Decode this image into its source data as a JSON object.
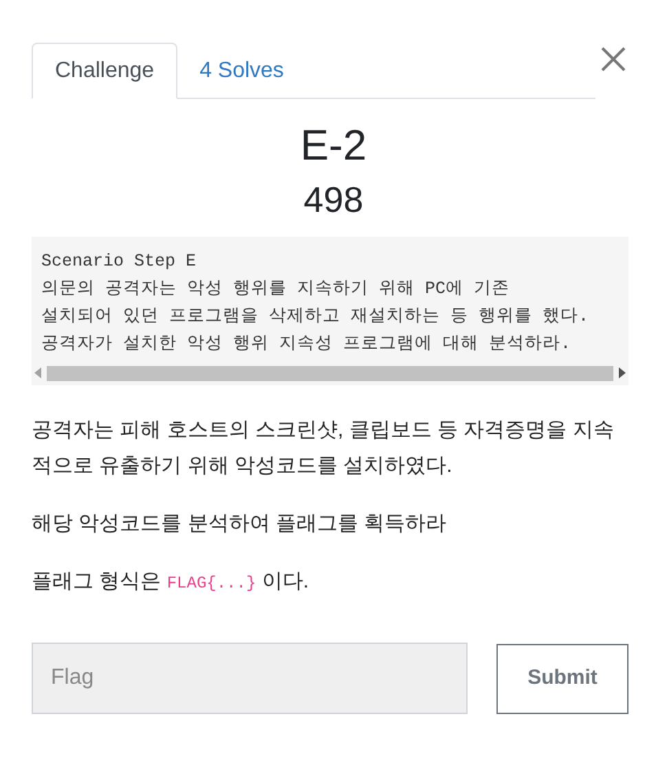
{
  "tabs": [
    {
      "label": "Challenge",
      "selected": true
    },
    {
      "label": "4 Solves",
      "selected": false
    }
  ],
  "title": "E-2",
  "points": "498",
  "scenario_lines": [
    "Scenario Step E",
    "의문의 공격자는 악성 행위를 지속하기 위해 PC에 기존",
    "설치되어 있던 프로그램을 삭제하고 재설치하는 등 행위를 했다.",
    "공격자가 설치한 악성 행위 지속성 프로그램에 대해 분석하라."
  ],
  "paragraphs": [
    {
      "kind": "text",
      "text": "공격자는 피해 호스트의 스크린샷, 클립보드 등 자격증명을 지속적으로 유출하기 위해 악성코드를 설치하였다."
    },
    {
      "kind": "text",
      "text": "해당 악성코드를 분석하여 플래그를 획득하라"
    },
    {
      "kind": "code",
      "before": "플래그 형식은",
      "code": "FLAG{...}",
      "after": "이다."
    }
  ],
  "flag_field": {
    "placeholder": "Flag"
  },
  "submit_button": "Submit"
}
